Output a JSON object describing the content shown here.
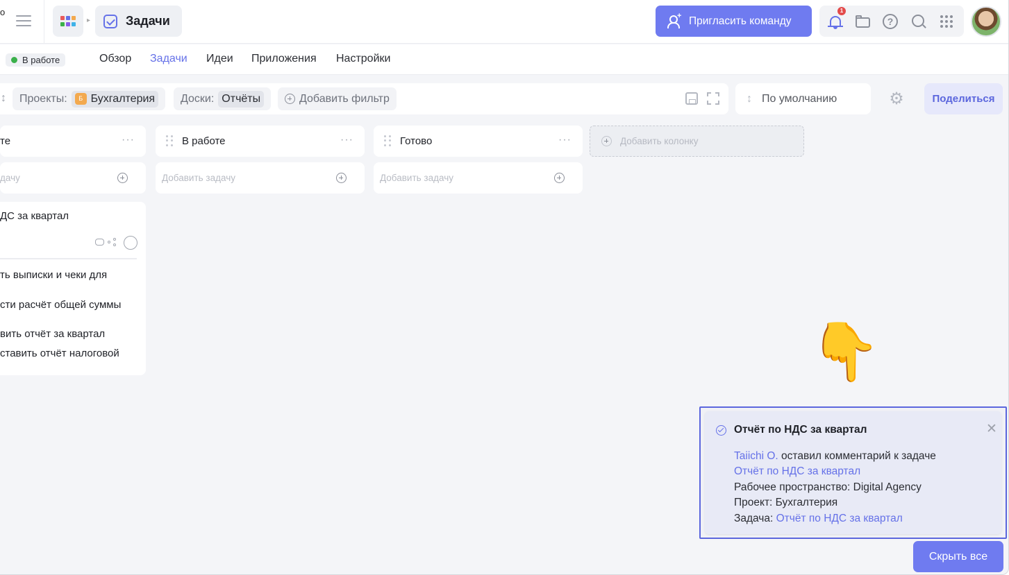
{
  "topbar": {
    "clipped_text": "о",
    "page_title": "Задачи",
    "invite_label": "Пригласить команду",
    "notification_count": "1",
    "help_glyph": "?"
  },
  "subnav": {
    "status": "В работе",
    "tabs": [
      {
        "label": "Обзор",
        "active": false
      },
      {
        "label": "Задачи",
        "active": true
      },
      {
        "label": "Идеи",
        "active": false
      },
      {
        "label": "Приложения",
        "active": false
      },
      {
        "label": "Настройки",
        "active": false
      }
    ]
  },
  "filters": {
    "projects_label": "Проекты:",
    "project_badge": "Б",
    "project_value": "Бухгалтерия",
    "boards_label": "Доски:",
    "boards_value": "Отчёты",
    "add_filter_label": "Добавить фильтр",
    "sort_label": "По умолчанию",
    "share_label": "Поделиться"
  },
  "board": {
    "columns": [
      {
        "title": "те",
        "add_placeholder": "дачу"
      },
      {
        "title": "В работе",
        "add_placeholder": "Добавить задачу"
      },
      {
        "title": "Готово",
        "add_placeholder": "Добавить задачу"
      }
    ],
    "add_column_label": "Добавить колонку",
    "more_glyph": "···",
    "card": {
      "title": "ДС за квартал",
      "subitems": [
        "ть выписки и чеки для",
        "сти расчёт общей суммы",
        "вить отчёт за квартал",
        "ставить отчёт налоговой"
      ]
    }
  },
  "pointer_emoji": "👇",
  "notification": {
    "title": "Отчёт по НДС за квартал",
    "close_glyph": "✕",
    "user": "Taiichi O.",
    "action": " оставил комментарий к задаче",
    "task_link": "Отчёт по НДС за квартал",
    "workspace": "Рабочее пространство: Digital Agency",
    "project": "Проект: Бухгалтерия",
    "task_label": "Задача: ",
    "task_link_2": "Отчёт по НДС за квартал"
  },
  "hide_all_label": "Скрыть все",
  "colors": {
    "accent": "#6f7bf0",
    "link": "#6571e8",
    "status_green": "#3ab04a",
    "badge_red": "#e34b4b",
    "project_badge": "#f3a94e"
  },
  "icons": [
    "hamburger-icon",
    "apps-icon",
    "check-icon",
    "invite-user-icon",
    "bell-icon",
    "folder-icon",
    "help-icon",
    "search-icon",
    "grid-icon",
    "save-icon",
    "expand-icon",
    "sort-icon",
    "gear-icon",
    "drag-handle-icon",
    "comment-icon",
    "subtasks-icon",
    "plus-circle-icon",
    "close-icon"
  ]
}
